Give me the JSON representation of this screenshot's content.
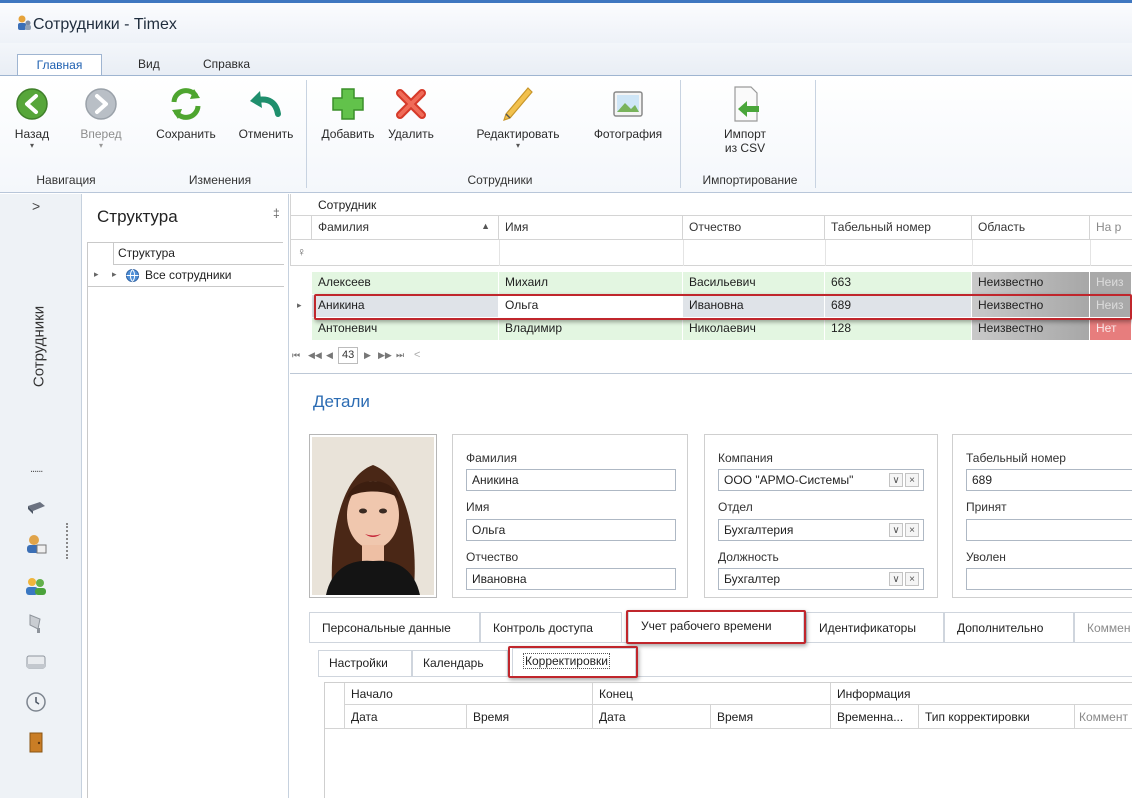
{
  "window": {
    "title": "Сотрудники - Timex"
  },
  "ribbon_tabs": [
    "Главная",
    "Вид",
    "Справка"
  ],
  "ribbon": {
    "back": "Назад",
    "forward": "Вперед",
    "save": "Сохранить",
    "cancel": "Отменить",
    "add": "Добавить",
    "delete": "Удалить",
    "edit": "Редактировать",
    "photo": "Фотография",
    "import_line1": "Импорт",
    "import_line2": "из CSV",
    "groups": {
      "nav": "Навигация",
      "changes": "Изменения",
      "employees": "Сотрудники",
      "import": "Импортирование"
    }
  },
  "leftnav": {
    "expand": ">",
    "vertical_label": "Сотрудники",
    "dots": "......"
  },
  "structure": {
    "title": "Структура",
    "pin": "‡",
    "tree_header": "Структура",
    "tree_item": "Все сотрудники"
  },
  "grid": {
    "panel_title": "Сотрудник",
    "columns": [
      "Фамилия",
      "Имя",
      "Отчество",
      "Табельный номер",
      "Область",
      "На р"
    ],
    "filter_icon": "♀",
    "rows": [
      {
        "last": "Алексеев",
        "first": "Михаил",
        "middle": "Васильевич",
        "num": "663",
        "area": "Неизвестно",
        "extra": "Неиз"
      },
      {
        "last": "Аникина",
        "first": "Ольга",
        "middle": "Ивановна",
        "num": "689",
        "area": "Неизвестно",
        "extra": "Неиз"
      },
      {
        "last": "Антоневич",
        "first": "Владимир",
        "middle": "Николаевич",
        "num": "128",
        "area": "Неизвестно",
        "extra": "Нет"
      }
    ],
    "pager": {
      "first": "⏮",
      "prev_page": "◀◀",
      "prev": "◀",
      "count": "43",
      "next": "▶",
      "next_page": "▶▶",
      "last": "⏭",
      "scroll": "<"
    }
  },
  "details": {
    "title": "Детали",
    "labels": {
      "last": "Фамилия",
      "first": "Имя",
      "middle": "Отчество",
      "company": "Компания",
      "dept": "Отдел",
      "position": "Должность",
      "tabnum": "Табельный номер",
      "hired": "Принят",
      "fired": "Уволен"
    },
    "values": {
      "last": "Аникина",
      "first": "Ольга",
      "middle": "Ивановна",
      "company": "ООО \"АРМО-Системы\"",
      "dept": "Бухгалтерия",
      "position": "Бухгалтер",
      "tabnum": "689",
      "hired": "",
      "fired": ""
    },
    "dd_open": "∨",
    "dd_clear": "×"
  },
  "tabs": [
    "Персональные данные",
    "Контроль доступа",
    "Учет рабочего времени",
    "Идентификаторы",
    "Дополнительно",
    "Коммен"
  ],
  "subtabs": [
    "Настройки",
    "Календарь",
    "Корректировки"
  ],
  "corrections_grid": {
    "groups": [
      "Начало",
      "Конец",
      "Информация"
    ],
    "columns": [
      "Дата",
      "Время",
      "Дата",
      "Время",
      "Временна...",
      "Тип корректировки",
      "Коммент"
    ]
  },
  "colors": {
    "accent": "#2c6cb3",
    "highlight": "#c0262c",
    "row_green": "#e3f6e1",
    "row_selected": "#dfe3e8",
    "area_gray": "#a9a9a9",
    "nope_red": "#e77d7d"
  }
}
